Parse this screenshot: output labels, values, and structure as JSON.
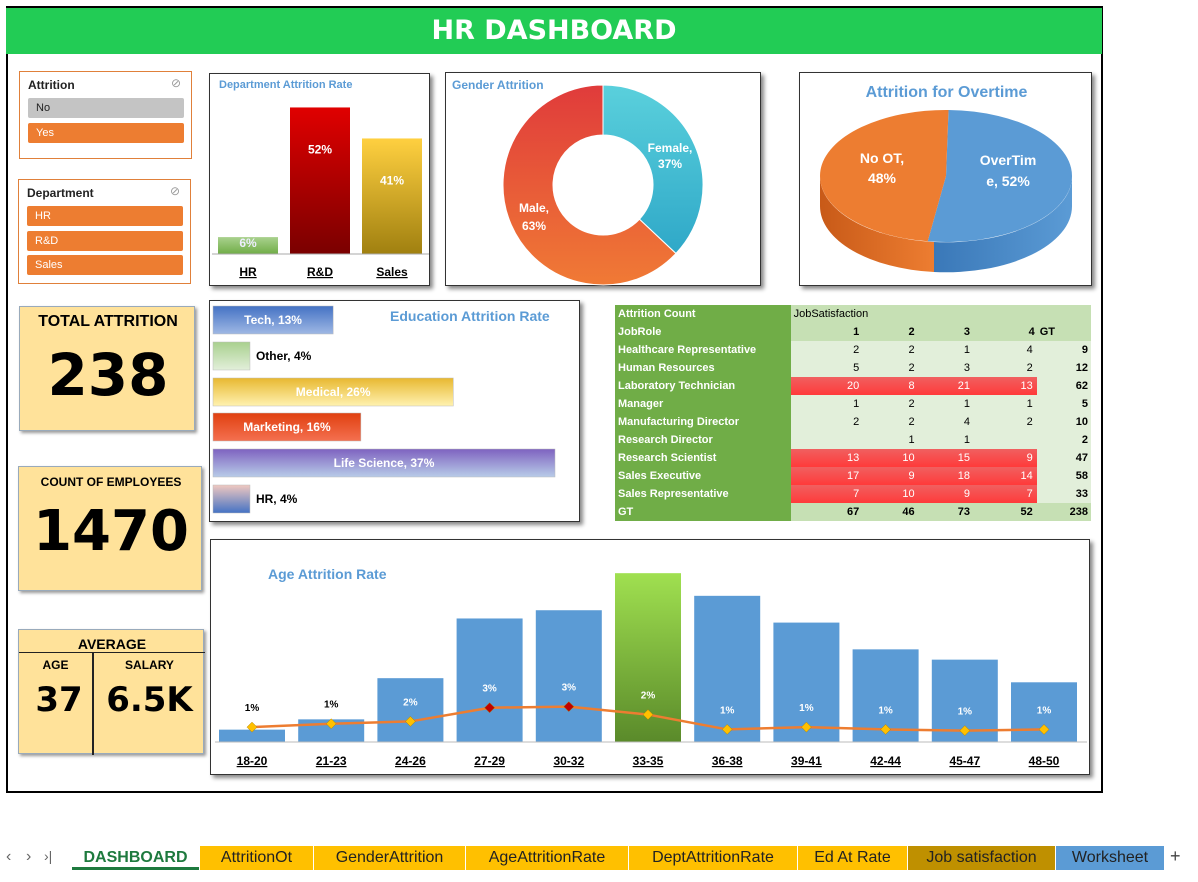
{
  "title": "HR DASHBOARD",
  "slicers": {
    "attrition": {
      "title": "Attrition",
      "items": [
        "No",
        "Yes"
      ]
    },
    "department": {
      "title": "Department",
      "items": [
        "HR",
        "R&D",
        "Sales"
      ]
    }
  },
  "kpis": {
    "total_attrition": {
      "label": "TOTAL ATTRITION",
      "value": "238"
    },
    "count_employees": {
      "label": "COUNT OF EMPLOYEES",
      "value": "1470"
    },
    "average": {
      "label": "AVERAGE",
      "age_label": "AGE",
      "age_value": "37",
      "salary_label": "SALARY",
      "salary_value": "6.5K"
    }
  },
  "chart_data": [
    {
      "type": "bar",
      "title": "Department Attrition Rate",
      "categories": [
        "HR",
        "R&D",
        "Sales"
      ],
      "values": [
        6,
        52,
        41
      ],
      "labels": [
        "6%",
        "52%",
        "41%"
      ],
      "colors": [
        "#70ad47",
        "#c00000",
        "#e8b830"
      ]
    },
    {
      "type": "pie",
      "title": "Gender Attrition",
      "categories": [
        "Female",
        "Male"
      ],
      "values": [
        37,
        63
      ],
      "labels": [
        "Female, 37%",
        "Male, 63%"
      ],
      "colors": [
        "#4fc6d6",
        "#ed7d31"
      ]
    },
    {
      "type": "pie",
      "title": "Attrition for Overtime",
      "categories": [
        "No OT",
        "OverTime"
      ],
      "values": [
        48,
        52
      ],
      "labels": [
        "No OT, 48%",
        "OverTime, 52%"
      ],
      "colors": [
        "#ed7d31",
        "#5b9bd5"
      ]
    },
    {
      "type": "bar",
      "title": "Education Attrition Rate",
      "categories": [
        "Tech",
        "Other",
        "Medical",
        "Marketing",
        "Life Science",
        "HR"
      ],
      "values": [
        13,
        4,
        26,
        16,
        37,
        4
      ],
      "labels": [
        "Tech, 13%",
        "Other, 4%",
        "Medical, 26%",
        "Marketing, 16%",
        "Life Science, 37%",
        "HR, 4%"
      ],
      "colors": [
        "#4472c4",
        "#a9d08e",
        "#e8b830",
        "#e04010",
        "#7e62c0",
        "#e8c0b8"
      ]
    },
    {
      "type": "bar",
      "title": "Age Attrition Rate",
      "categories": [
        "18-20",
        "21-23",
        "24-26",
        "27-29",
        "30-32",
        "33-35",
        "36-38",
        "39-41",
        "42-44",
        "45-47",
        "48-50"
      ],
      "values": [
        6,
        11,
        31,
        60,
        64,
        82,
        71,
        58,
        45,
        40,
        29
      ],
      "rate_labels": [
        "1%",
        "1%",
        "2%",
        "3%",
        "3%",
        "2%",
        "1%",
        "1%",
        "1%",
        "1%",
        "1%"
      ],
      "rate_values": [
        1.3,
        1.6,
        1.8,
        3.0,
        3.1,
        2.4,
        1.1,
        1.3,
        1.1,
        1.0,
        1.1
      ],
      "colors": {
        "bar": "#5b9bd5",
        "highlight": "#70ad47",
        "line": "#ed7d31",
        "marker": "#ffc000",
        "marker_high": "#c00000"
      }
    }
  ],
  "pivot": {
    "corner": "Attrition Count",
    "col_field": "JobSatisfaction",
    "row_field": "JobRole",
    "columns": [
      "1",
      "2",
      "3",
      "4",
      "GT"
    ],
    "rows": [
      {
        "role": "Healthcare Representative",
        "vals": [
          "2",
          "2",
          "1",
          "4",
          "9"
        ],
        "hl": [
          false,
          false,
          false,
          false
        ]
      },
      {
        "role": "Human Resources",
        "vals": [
          "5",
          "2",
          "3",
          "2",
          "12"
        ],
        "hl": [
          false,
          false,
          false,
          false
        ]
      },
      {
        "role": "Laboratory Technician",
        "vals": [
          "20",
          "8",
          "21",
          "13",
          "62"
        ],
        "hl": [
          true,
          true,
          true,
          true
        ]
      },
      {
        "role": "Manager",
        "vals": [
          "1",
          "2",
          "1",
          "1",
          "5"
        ],
        "hl": [
          false,
          false,
          false,
          false
        ]
      },
      {
        "role": "Manufacturing Director",
        "vals": [
          "2",
          "2",
          "4",
          "2",
          "10"
        ],
        "hl": [
          false,
          false,
          false,
          false
        ]
      },
      {
        "role": "Research Director",
        "vals": [
          "",
          "1",
          "1",
          "",
          "2"
        ],
        "hl": [
          false,
          false,
          false,
          false
        ]
      },
      {
        "role": "Research Scientist",
        "vals": [
          "13",
          "10",
          "15",
          "9",
          "47"
        ],
        "hl": [
          true,
          true,
          true,
          true
        ]
      },
      {
        "role": "Sales Executive",
        "vals": [
          "17",
          "9",
          "18",
          "14",
          "58"
        ],
        "hl": [
          true,
          true,
          true,
          true
        ]
      },
      {
        "role": "Sales Representative",
        "vals": [
          "7",
          "10",
          "9",
          "7",
          "33"
        ],
        "hl": [
          true,
          true,
          true,
          true
        ]
      }
    ],
    "total": {
      "role": "GT",
      "vals": [
        "67",
        "46",
        "73",
        "52",
        "238"
      ]
    }
  },
  "tabs": [
    {
      "label": "DASHBOARD",
      "active": true,
      "color": "#ffffff"
    },
    {
      "label": "AttritionOt",
      "color": "#ffc000"
    },
    {
      "label": "GenderAttrition",
      "color": "#ffc000"
    },
    {
      "label": "AgeAttritionRate",
      "color": "#ffc000"
    },
    {
      "label": "DeptAttritionRate",
      "color": "#ffc000"
    },
    {
      "label": "Ed At Rate",
      "color": "#ffc000"
    },
    {
      "label": "Job satisfaction",
      "color": "#bf9000"
    },
    {
      "label": "Worksheet",
      "color": "#5b9bd5"
    }
  ],
  "nav": {
    "prev_glyph": "‹",
    "next_glyph": "›",
    "last_glyph": "›|",
    "add_glyph": "+"
  }
}
